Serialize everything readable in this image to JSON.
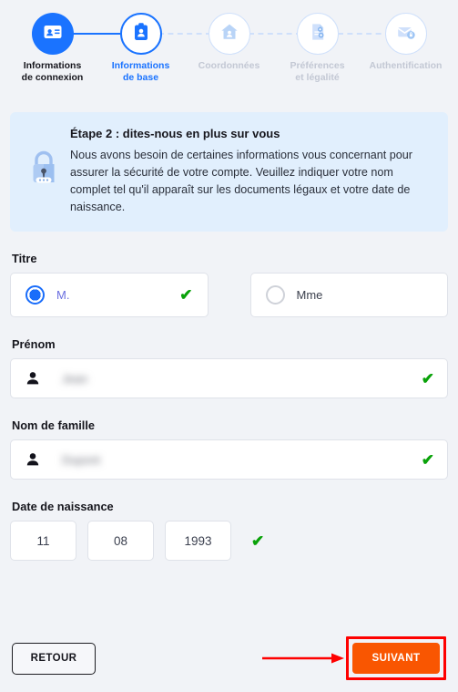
{
  "stepper": {
    "steps": [
      {
        "label": "Informations\nde connexion",
        "label_line1": "Informations",
        "label_line2": "de connexion",
        "state": "done",
        "icon": "id-card-icon"
      },
      {
        "label": "Informations de base",
        "label_line1": "Informations",
        "label_line2": "de base",
        "state": "current",
        "icon": "id-badge-icon"
      },
      {
        "label": "Coordonnées",
        "label_line1": "Coordonnées",
        "label_line2": "",
        "state": "todo",
        "icon": "home-icon"
      },
      {
        "label": "Préférences et légalité",
        "label_line1": "Préférences",
        "label_line2": "et légalité",
        "state": "todo",
        "icon": "document-settings-icon"
      },
      {
        "label": "Authentification",
        "label_line1": "Authentification",
        "label_line2": "",
        "state": "todo",
        "icon": "mail-lock-icon"
      }
    ],
    "colors": {
      "active": "#1a73ff",
      "inactive": "#c3c8d4",
      "connector": "#cfe0fb"
    }
  },
  "info": {
    "icon": "padlock-icon",
    "title": "Étape 2 : dites-nous en plus sur vous",
    "body": "Nous avons besoin de certaines informations vous concernant pour assurer la sécurité de votre compte. Veuillez indiquer votre nom complet tel qu'il apparaît sur les documents légaux et votre date de naissance.",
    "background": "#e1effd"
  },
  "form": {
    "title_label": "Titre",
    "title_options": [
      {
        "label": "M.",
        "selected": true,
        "valid": true
      },
      {
        "label": "Mme",
        "selected": false,
        "valid": false
      }
    ],
    "firstname_label": "Prénom",
    "firstname_value": "Jean",
    "firstname_valid": true,
    "lastname_label": "Nom de famille",
    "lastname_value": "Dupont",
    "lastname_valid": true,
    "birthdate_label": "Date de naissance",
    "birthdate": {
      "day": "11",
      "month": "08",
      "year": "1993"
    },
    "birthdate_valid": true,
    "check_mark": "✔",
    "check_color": "#09a209"
  },
  "footer": {
    "back_label": "RETOUR",
    "next_label": "SUIVANT",
    "next_color": "#f95601",
    "highlight_color": "#fe0000"
  }
}
